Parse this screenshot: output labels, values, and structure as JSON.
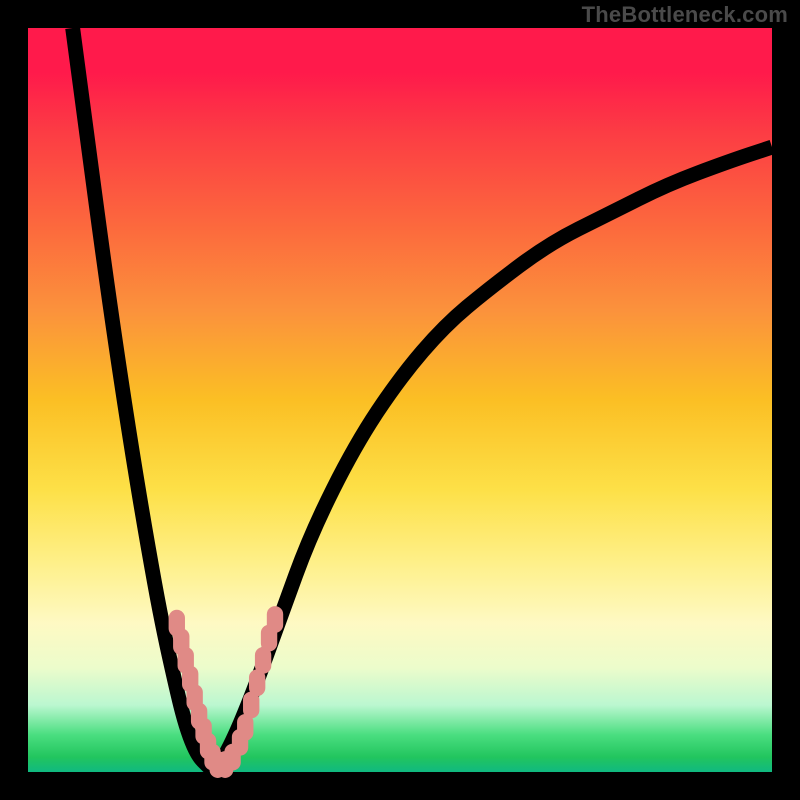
{
  "watermark": "TheBottleneck.com",
  "chart_data": {
    "type": "line",
    "title": "",
    "xlabel": "",
    "ylabel": "",
    "xlim": [
      0,
      100
    ],
    "ylim": [
      0,
      100
    ],
    "grid": false,
    "legend": false,
    "series": [
      {
        "name": "left-branch",
        "x": [
          6,
          8,
          10,
          12,
          14,
          16,
          18,
          20,
          21,
          22,
          23,
          24,
          25
        ],
        "y": [
          100,
          85,
          70,
          56,
          43,
          31,
          20,
          11,
          7,
          4,
          2,
          1,
          0
        ]
      },
      {
        "name": "right-branch",
        "x": [
          25,
          27,
          30,
          34,
          38,
          44,
          50,
          56,
          62,
          70,
          78,
          86,
          94,
          100
        ],
        "y": [
          0,
          3,
          10,
          21,
          32,
          44,
          53,
          60,
          65,
          71,
          75,
          79,
          82,
          84
        ]
      }
    ],
    "markers": {
      "name": "highlighted-points",
      "points": [
        {
          "x": 20.0,
          "y": 20.0
        },
        {
          "x": 20.6,
          "y": 17.5
        },
        {
          "x": 21.2,
          "y": 15.0
        },
        {
          "x": 21.8,
          "y": 12.5
        },
        {
          "x": 22.4,
          "y": 10.0
        },
        {
          "x": 23.0,
          "y": 7.5
        },
        {
          "x": 23.6,
          "y": 5.5
        },
        {
          "x": 24.2,
          "y": 3.5
        },
        {
          "x": 24.8,
          "y": 2.0
        },
        {
          "x": 25.5,
          "y": 1.0
        },
        {
          "x": 26.5,
          "y": 1.0
        },
        {
          "x": 27.5,
          "y": 2.0
        },
        {
          "x": 28.5,
          "y": 4.0
        },
        {
          "x": 29.2,
          "y": 6.0
        },
        {
          "x": 30.0,
          "y": 9.0
        },
        {
          "x": 30.8,
          "y": 12.0
        },
        {
          "x": 31.6,
          "y": 15.0
        },
        {
          "x": 32.4,
          "y": 18.0
        },
        {
          "x": 33.2,
          "y": 20.5
        }
      ]
    },
    "gradient_stops": [
      {
        "pos": 0,
        "color": "#ff1a4b"
      },
      {
        "pos": 50,
        "color": "#fde047"
      },
      {
        "pos": 100,
        "color": "#10b981"
      }
    ]
  }
}
